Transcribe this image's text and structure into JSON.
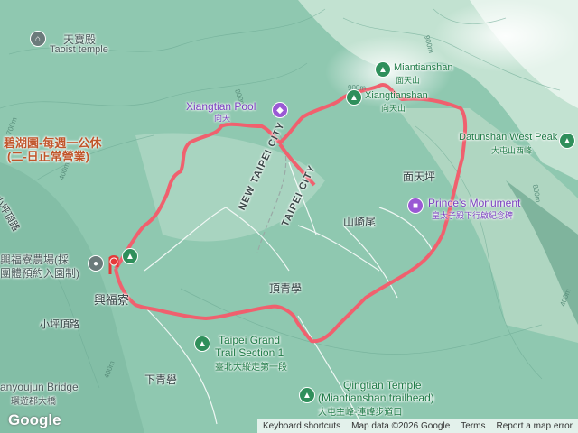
{
  "poi": {
    "tianbao_zh": "天寶殿",
    "tianbao_en": "Taoist temple",
    "miantianshan_en": "Miantianshan",
    "miantianshan_zh": "面天山",
    "xiangtian_en": "Xiangtian Pool",
    "xiangtian_zh": "向天",
    "xiangtianshan_en": "Xiangtianshan",
    "xiangtianshan_zh": "向天山",
    "datun_west_en": "Datunshan West Peak",
    "datun_west_zh": "大屯山西峰",
    "prince_en": "Prince's Monument",
    "prince_zh": "皇太子殿下行啟紀念碑",
    "farm_zh1": "興福寮農場(採",
    "farm_zh2": "團體預約入園制)",
    "bihu_1": "碧湖園-每週一公休",
    "bihu_2": "(二-日正常營業)",
    "grand_trail_en1": "Taipei Grand",
    "grand_trail_en2": "Trail Section 1",
    "grand_trail_zh": "臺北大縱走第一段",
    "qingtian_en": "Qingtian Temple",
    "qingtian_sub": "(Miantianshan trailhead)",
    "qingtian_zh": "大屯主峰-連峰步道口",
    "bridge_en": "anyoujun Bridge",
    "bridge_zh": "環遊郡大橋"
  },
  "places": {
    "mian_tian_ping": "面天坪",
    "shan_qi_wei": "山崎尾",
    "ding_qing_xue": "頂青學",
    "xing_fu_liao": "興福寮",
    "xiao_ping_ding": "小坪頂路",
    "xia_qing_xue": "下青礐",
    "xiao_ping_ding_road": "小坪頂路"
  },
  "districts": {
    "new_taipei": "NEW TAIPEI CITY",
    "taipei": "TAIPEI CITY"
  },
  "contours": [
    "700m",
    "800m",
    "900m",
    "900m",
    "800m",
    "400m",
    "400m",
    "500m",
    "600m",
    "700m",
    "800m",
    "500m",
    "600m",
    "400m",
    "300m"
  ],
  "footer": {
    "shortcuts": "Keyboard shortcuts",
    "map_data": "Map data ©2026 Google",
    "terms": "Terms",
    "report": "Report a map error"
  },
  "logo": "Google",
  "colors": {
    "route": "#f0606e",
    "terrain": "#8fc8b0",
    "ridge": "#c9e4d6"
  }
}
